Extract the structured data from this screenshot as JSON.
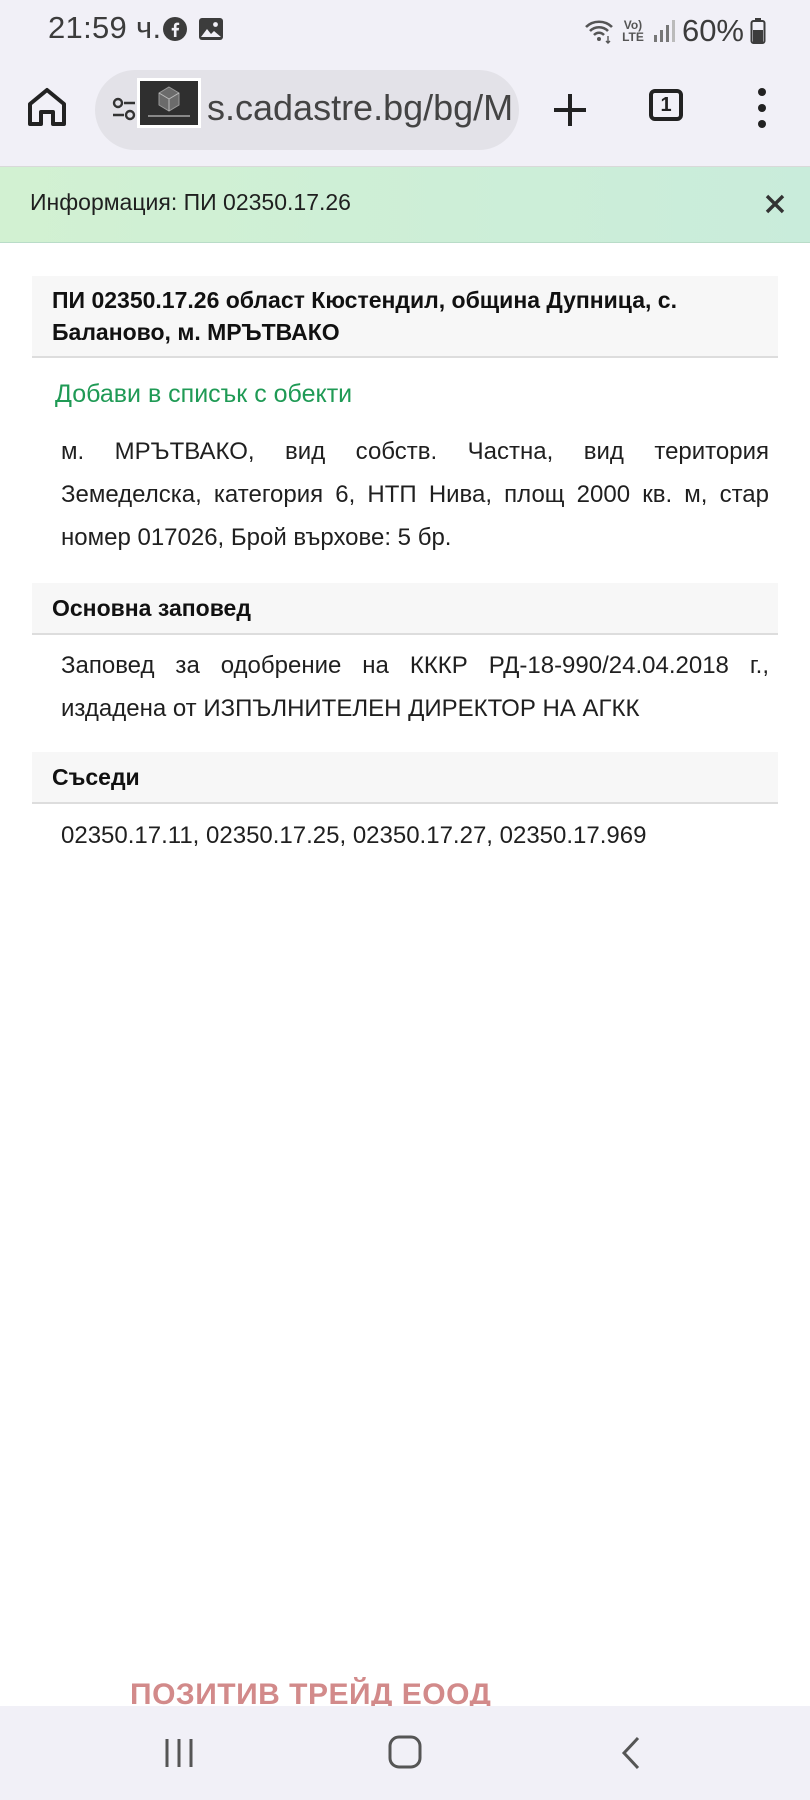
{
  "status_bar": {
    "time": "21:59 ч.",
    "battery": "60%",
    "volte_label_line1": "Vo)",
    "volte_label_line2": "LTE",
    "icons": [
      "facebook-icon",
      "gallery-icon",
      "wifi-icon",
      "volte-icon",
      "signal-icon",
      "battery-icon"
    ]
  },
  "browser": {
    "url": "s.cadastre.bg/bg/M",
    "tab_count": "1",
    "icons": [
      "home-icon",
      "site-settings-icon",
      "new-tab-icon",
      "tab-switcher-icon",
      "more-menu-icon"
    ]
  },
  "info_banner": {
    "title": "Информация: ПИ 02350.17.26",
    "close_icon": "close-icon"
  },
  "plot": {
    "heading": "ПИ 02350.17.26 област Кюстендил, община Дупница, с. Баланово, м. МРЪТВАКО",
    "add_link": "Добави в списък с обекти",
    "description": "м. МРЪТВАКО, вид собств. Частна, вид територия Земеделска, категория 6, НТП Нива, площ 2000 кв. м, стар номер 017026, Брой върхове: 5 бр."
  },
  "order_section": {
    "heading": "Основна заповед",
    "text": "Заповед за одобрение на КККР РД-18-990/24.04.2018 г., издадена от ИЗПЪЛНИТЕЛЕН ДИРЕКТОР НА АГКК"
  },
  "neighbours_section": {
    "heading": "Съседи",
    "text": "02350.17.11, 02350.17.25, 02350.17.27, 02350.17.969"
  },
  "watermark": "ПОЗИТИВ ТРЕЙД ЕООД",
  "nav_bar": {
    "icons": [
      "recent-apps-icon",
      "home-icon",
      "back-icon"
    ]
  },
  "colors": {
    "link_green": "#1f9a55",
    "banner_green": "#d2f1d2",
    "watermark_red": "#d28a8a",
    "system_bar": "#f1f0f7"
  }
}
